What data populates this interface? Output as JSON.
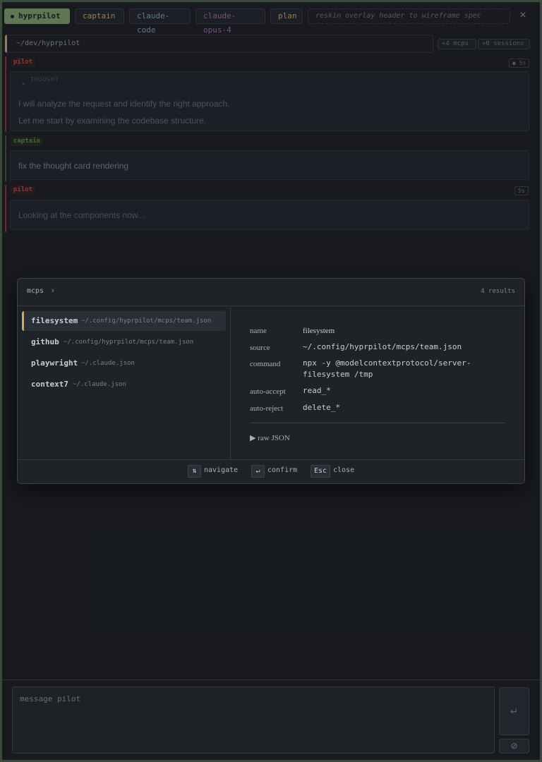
{
  "header": {
    "app_label": "hyprpilot",
    "captain_label": "captain",
    "agent_label": "claude-code",
    "model_label": "claude-opus-4",
    "mode_label": "plan",
    "task_title": "reskin overlay header to wireframe spec",
    "close_icon": "×"
  },
  "path": {
    "cwd": "~/dev/hyprpilot",
    "mcps_badge": "+4 mcps",
    "sessions_badge": "+0 sessions"
  },
  "conversation": {
    "turn1": {
      "role": "pilot",
      "elapsed": "● 5s",
      "thought_label": "THOUGHT",
      "thought_lines": [
        "I will analyze the request and identify the right approach.",
        "Let me start by examining the codebase structure."
      ]
    },
    "turn2": {
      "role": "captain",
      "text": "fix the thought card rendering"
    },
    "turn3": {
      "role": "pilot",
      "elapsed": "5s",
      "text": "Looking at the components now..."
    }
  },
  "palette": {
    "breadcrumb": "mcps",
    "breadcrumb_sep": "›",
    "results_count": "4 results",
    "items": [
      {
        "name": "filesystem",
        "path": "~/.config/hyprpilot/mcps/team.json"
      },
      {
        "name": "github",
        "path": "~/.config/hyprpilot/mcps/team.json"
      },
      {
        "name": "playwright",
        "path": "~/.claude.json"
      },
      {
        "name": "context7",
        "path": "~/.claude.json"
      }
    ],
    "detail": {
      "name_label": "name",
      "name_value": "filesystem",
      "source_label": "source",
      "source_value": "~/.config/hyprpilot/mcps/team.json",
      "command_label": "command",
      "command_line1": "npx -y @modelcontextprotocol/server-",
      "command_line2": "filesystem /tmp",
      "accept_label": "auto-accept",
      "accept_value": "read_*",
      "reject_label": "auto-reject",
      "reject_value": "delete_*",
      "raw_json_label": "▶  raw JSON"
    },
    "footer": {
      "navigate_key": "⇅",
      "navigate_label": "navigate",
      "confirm_key": "↵",
      "confirm_label": "confirm",
      "close_key": "Esc",
      "close_label": "close"
    }
  },
  "composer": {
    "placeholder": "message pilot",
    "send_icon": "↵",
    "attach_icon": "⊘"
  },
  "colors": {
    "app_accent": "#7a9a6a",
    "pilot": "#b04848",
    "captain": "#5a8a4a",
    "selection_accent": "#d4a85a"
  }
}
